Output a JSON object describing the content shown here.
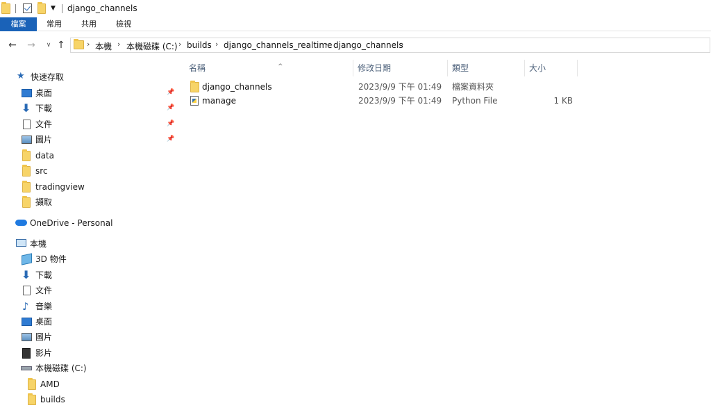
{
  "window": {
    "title": "django_channels"
  },
  "ribbon": {
    "tabs": [
      "檔案",
      "常用",
      "共用",
      "檢視"
    ]
  },
  "address": {
    "crumbs": [
      "本機",
      "本機磁碟 (C:)",
      "builds",
      "django_channels_realtime",
      "django_channels"
    ]
  },
  "navpane": {
    "quick_access": "快速存取",
    "pinned": [
      {
        "label": "桌面",
        "icon": "desktop-icon"
      },
      {
        "label": "下載",
        "icon": "download-icon"
      },
      {
        "label": "文件",
        "icon": "document-icon"
      },
      {
        "label": "圖片",
        "icon": "picture-icon"
      }
    ],
    "recent_folders": [
      "data",
      "src",
      "tradingview",
      "擷取"
    ],
    "onedrive": "OneDrive - Personal",
    "this_pc": "本機",
    "pc_items": [
      {
        "label": "3D 物件",
        "icon": "3d-objects-icon"
      },
      {
        "label": "下載",
        "icon": "download-icon"
      },
      {
        "label": "文件",
        "icon": "document-icon"
      },
      {
        "label": "音樂",
        "icon": "music-icon"
      },
      {
        "label": "桌面",
        "icon": "desktop-icon"
      },
      {
        "label": "圖片",
        "icon": "picture-icon"
      },
      {
        "label": "影片",
        "icon": "video-icon"
      },
      {
        "label": "本機磁碟 (C:)",
        "icon": "drive-icon"
      }
    ],
    "drive_children": [
      "AMD",
      "builds"
    ]
  },
  "filelist": {
    "columns": [
      "名稱",
      "修改日期",
      "類型",
      "大小"
    ],
    "rows": [
      {
        "name": "django_channels",
        "modified": "2023/9/9 下午 01:49",
        "type": "檔案資料夾",
        "size": "",
        "icon": "folder-icon"
      },
      {
        "name": "manage",
        "modified": "2023/9/9 下午 01:49",
        "type": "Python File",
        "size": "1 KB",
        "icon": "python-file-icon"
      }
    ]
  },
  "colors": {
    "accent": "#1a62b8",
    "folder": "#f7d468",
    "header_text": "#4c607a"
  }
}
